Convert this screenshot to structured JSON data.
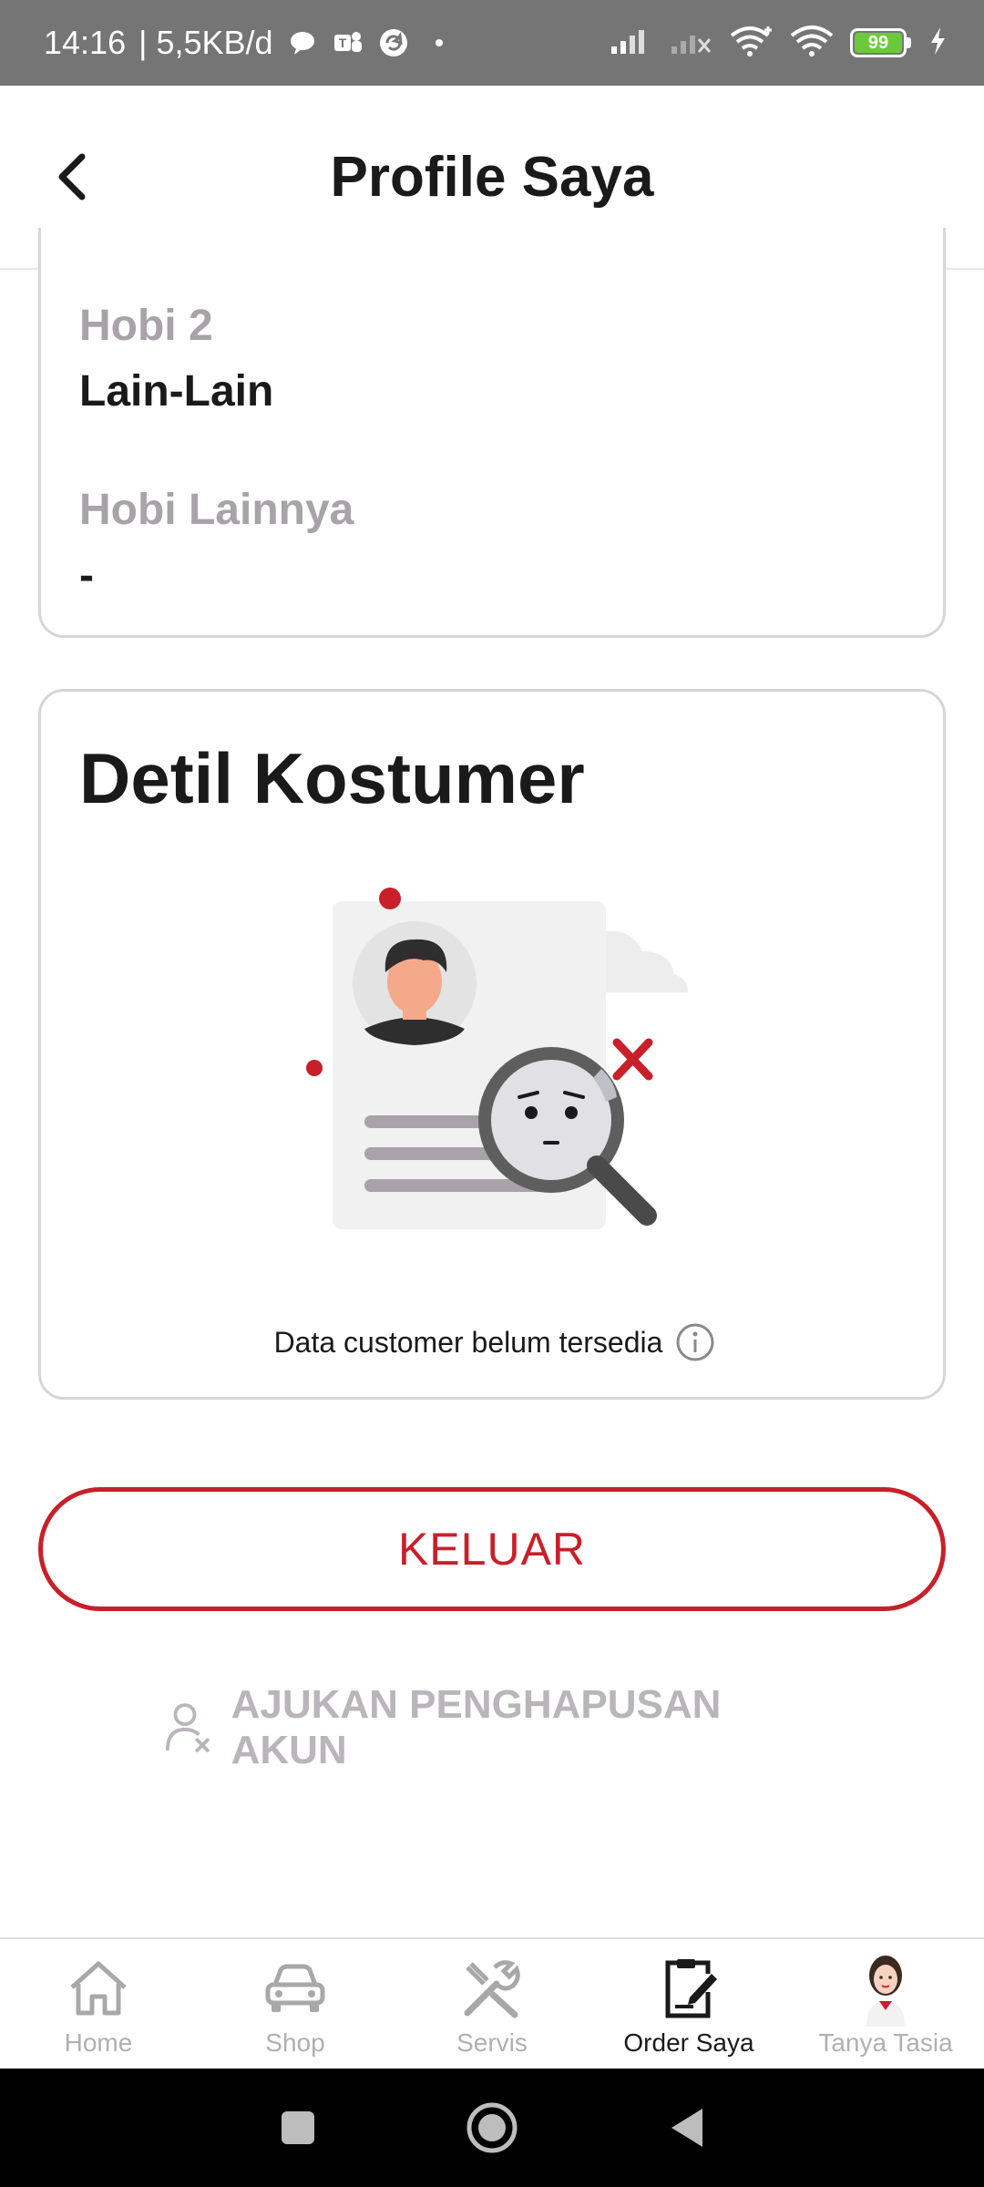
{
  "status_bar": {
    "time": "14:16",
    "network_speed": "| 5,5KB/d",
    "battery_level": "99",
    "icons": [
      "chat-icon",
      "teams-icon",
      "sync-icon",
      "dot-icon",
      "signal-icon",
      "signal-off-icon",
      "wifi-plus-icon",
      "wifi-icon",
      "battery-icon",
      "charging-icon"
    ]
  },
  "header": {
    "title": "Profile Saya",
    "back_icon": "chevron-left-icon"
  },
  "hobby_section": {
    "hobby2_label": "Hobi 2",
    "hobby2_value": "Lain-Lain",
    "other_label": "Hobi Lainnya",
    "other_value": "-"
  },
  "customer_detail": {
    "title": "Detil Kostumer",
    "illustration": "customer-not-found-illustration",
    "empty_message": "Data customer belum tersedia",
    "info_icon": "info-icon"
  },
  "actions": {
    "logout_label": "KELUAR",
    "delete_account_label": "AJUKAN PENGHAPUSAN AKUN",
    "delete_icon": "user-remove-icon"
  },
  "bottom_nav": {
    "items": [
      {
        "label": "Home",
        "icon": "home-icon",
        "active": false
      },
      {
        "label": "Shop",
        "icon": "car-icon",
        "active": false
      },
      {
        "label": "Servis",
        "icon": "tools-icon",
        "active": false
      },
      {
        "label": "Order Saya",
        "icon": "clipboard-edit-icon",
        "active": true
      },
      {
        "label": "Tanya Tasia",
        "icon": "assistant-avatar-icon",
        "active": false
      }
    ]
  },
  "colors": {
    "accent": "#c8202a",
    "label_gray": "#a8a3a8",
    "status_bar": "#757575",
    "battery": "#6cc93b"
  }
}
